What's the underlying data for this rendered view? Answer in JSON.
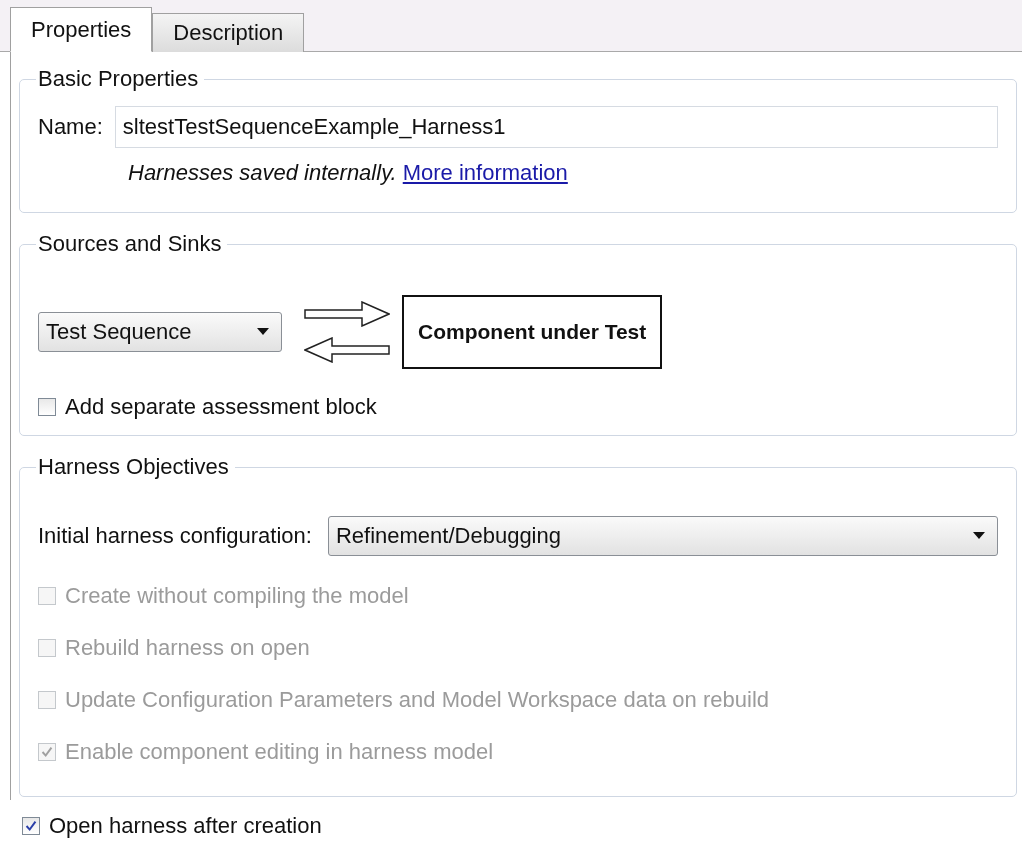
{
  "tabs": [
    {
      "label": "Properties",
      "selected": true
    },
    {
      "label": "Description",
      "selected": false
    }
  ],
  "basic_properties": {
    "title": "Basic Properties",
    "name_label": "Name:",
    "name_value": "sltestTestSequenceExample_Harness1",
    "note": "Harnesses saved internally.",
    "link": "More information"
  },
  "sources_and_sinks": {
    "title": "Sources and Sinks",
    "source": "Test Sequence",
    "component": "Component under Test",
    "assessment": {
      "label": "Add separate assessment block",
      "checked": false,
      "disabled": false
    }
  },
  "harness_objectives": {
    "title": "Harness Objectives",
    "config_label": "Initial harness configuration:",
    "config_value": "Refinement/Debugging",
    "options": [
      {
        "label": "Create without compiling the model",
        "checked": false,
        "disabled": true
      },
      {
        "label": "Rebuild harness on open",
        "checked": false,
        "disabled": true
      },
      {
        "label": "Update Configuration Parameters and Model Workspace data on rebuild",
        "checked": false,
        "disabled": true
      },
      {
        "label": "Enable component editing in harness model",
        "checked": true,
        "disabled": true
      }
    ]
  },
  "open_after": {
    "label": "Open harness after creation",
    "checked": true,
    "disabled": false
  }
}
